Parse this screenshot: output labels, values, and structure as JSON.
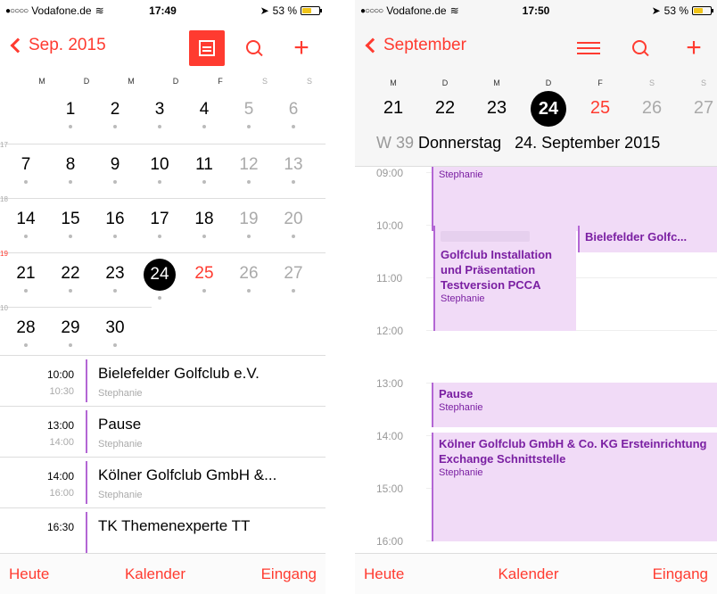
{
  "left": {
    "status": {
      "carrier": "Vodafone.de",
      "time": "17:49",
      "battery": "53 %"
    },
    "nav": {
      "back_label": "Sep. 2015"
    },
    "weekdays": [
      "M",
      "D",
      "M",
      "D",
      "F",
      "S",
      "S"
    ],
    "weeks": [
      {
        "num": "",
        "days": [
          "",
          "",
          "1",
          "2",
          "3",
          "4",
          "5",
          "6"
        ]
      },
      {
        "num": "17",
        "days": [
          "7",
          "8",
          "9",
          "10",
          "11",
          "12",
          "13"
        ]
      },
      {
        "num": "18",
        "days": [
          "14",
          "15",
          "16",
          "17",
          "18",
          "19",
          "20"
        ]
      },
      {
        "num": "19",
        "days": [
          "21",
          "22",
          "23",
          "24",
          "25",
          "26",
          "27"
        ]
      },
      {
        "num": "10",
        "days": [
          "28",
          "29",
          "30"
        ]
      }
    ],
    "events": [
      {
        "start": "10:00",
        "end": "10:30",
        "title": "Bielefelder Golfclub e.V.",
        "who": "Stephanie"
      },
      {
        "start": "13:00",
        "end": "14:00",
        "title": "Pause",
        "who": "Stephanie"
      },
      {
        "start": "14:00",
        "end": "16:00",
        "title": "Kölner Golfclub GmbH &...",
        "who": "Stephanie"
      },
      {
        "start": "16:30",
        "end": "",
        "title": "TK Themenexperte TT",
        "who": ""
      }
    ],
    "tabs": {
      "today": "Heute",
      "calendar": "Kalender",
      "inbox": "Eingang"
    }
  },
  "right": {
    "status": {
      "carrier": "Vodafone.de",
      "time": "17:50",
      "battery": "53 %"
    },
    "nav": {
      "back_label": "September"
    },
    "weekdays": [
      "M",
      "D",
      "M",
      "D",
      "F",
      "S",
      "S"
    ],
    "strip": [
      "21",
      "22",
      "23",
      "24",
      "25",
      "26",
      "27"
    ],
    "dateline": {
      "week": "W 39",
      "weekday": "Donnerstag",
      "date": "24. September 2015"
    },
    "hours": [
      "09:00",
      "10:00",
      "11:00",
      "12:00",
      "13:00",
      "14:00",
      "15:00",
      "16:00"
    ],
    "events": {
      "e0_who": "Stephanie",
      "e1_title": "Golfclub Installation und Präsentation Testversion PCCA",
      "e1_who": "Stephanie",
      "e2_title": "Bielefelder Golfc...",
      "e3_title": "Pause",
      "e3_who": "Stephanie",
      "e4_title": "Kölner Golfclub GmbH & Co. KG Ersteinrichtung Exchange Schnittstelle",
      "e4_who": "Stephanie"
    },
    "tabs": {
      "today": "Heute",
      "calendar": "Kalender",
      "inbox": "Eingang"
    }
  },
  "colors": {
    "accent": "#ff3b30",
    "event_fill": "#f1dbf7",
    "event_bar": "#b366d4",
    "event_text": "#7a1fa2"
  }
}
